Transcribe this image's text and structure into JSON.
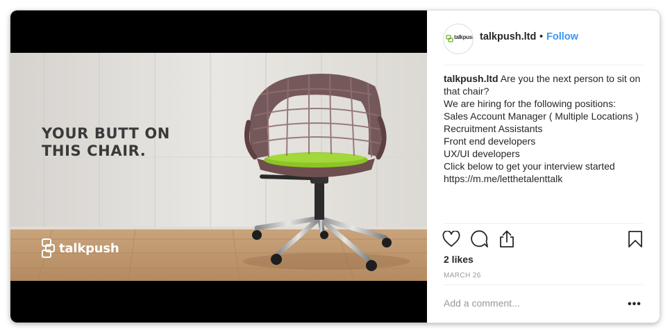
{
  "post": {
    "headline_line1": "YOUR BUTT ON",
    "headline_line2": "THIS CHAIR.",
    "brand_text": "talkpush"
  },
  "header": {
    "avatar_text": "talkpush",
    "username": "talkpush.ltd",
    "dot": "•",
    "follow": "Follow"
  },
  "caption": {
    "username": "talkpush.ltd",
    "lines": [
      "Are you the next person to sit on that chair?",
      "We are hiring for the following positions:",
      "Sales Account Manager ( Multiple Locations )",
      "Recruitment Assistants",
      "Front end developers",
      "UX/UI developers",
      "Click below to get your interview started",
      "https://m.me/letthetalenttalk"
    ]
  },
  "actions": {
    "like_icon": "heart-icon",
    "comment_icon": "speech-bubble-icon",
    "share_icon": "share-icon",
    "save_icon": "bookmark-icon"
  },
  "likes": "2 likes",
  "date": "MARCH 26",
  "comment": {
    "placeholder": "Add a comment...",
    "more": "•••"
  },
  "colors": {
    "link_blue": "#3897f0",
    "text": "#262626",
    "muted": "#999999",
    "seat_green": "#8cc524"
  }
}
